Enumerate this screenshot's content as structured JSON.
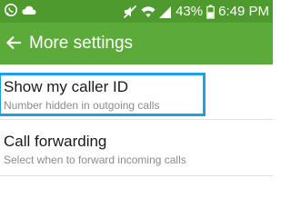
{
  "status_bar": {
    "left_icons": [
      "whatsapp-icon",
      "cloud-icon"
    ],
    "right_icons": [
      "mute-icon",
      "wifi-icon",
      "signal-icon"
    ],
    "battery": "43%",
    "time": "6:49 PM",
    "colors": {
      "background": "#4e9a2f",
      "text": "#ffffff"
    }
  },
  "app_bar": {
    "back_icon": "back-arrow-icon",
    "title": "More settings",
    "color": "#5cab3a"
  },
  "settings": [
    {
      "title": "Show my caller ID",
      "subtitle": "Number hidden in outgoing calls",
      "highlighted": true
    },
    {
      "title": "Call forwarding",
      "subtitle": "Select when to forward incoming calls",
      "highlighted": false
    }
  ],
  "highlight_color": "#1da1e2"
}
